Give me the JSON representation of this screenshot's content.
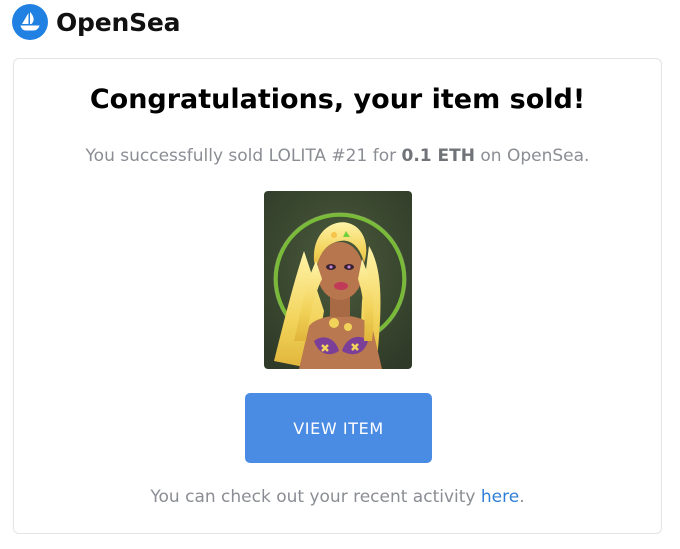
{
  "brand": {
    "name": "OpenSea",
    "logo_icon": "opensea-sailboat-icon",
    "logo_color": "#2081e2"
  },
  "email": {
    "title": "Congratulations, your item sold!",
    "subtitle_prefix": "You successfully sold LOLITA #21 for ",
    "price": "0.1 ETH",
    "subtitle_suffix": " on OpenSea.",
    "button_label": "VIEW ITEM",
    "button_color": "#4a8be4",
    "footer_prefix": "You can check out your recent activity ",
    "footer_link": "here",
    "footer_suffix": "."
  }
}
